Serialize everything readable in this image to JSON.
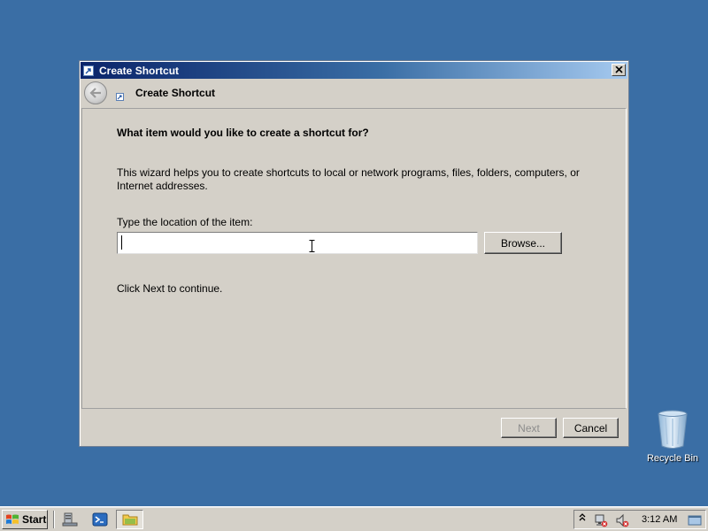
{
  "window": {
    "title": "Create Shortcut",
    "close_label": "×"
  },
  "wizard": {
    "header_title": "Create Shortcut",
    "question": "What item would you like to create a shortcut for?",
    "description": "This wizard helps you to create shortcuts to local or network programs, files, folders, computers, or Internet addresses.",
    "location_label": "Type the location of the item:",
    "location_value": "",
    "browse_label": "Browse...",
    "continue_text": "Click Next to continue.",
    "next_label": "Next",
    "next_enabled": false,
    "cancel_label": "Cancel"
  },
  "desktop": {
    "icons": [
      {
        "label": "Recycle Bin",
        "icon": "recycle-bin-icon"
      }
    ],
    "background_color": "#3a6ea5"
  },
  "taskbar": {
    "start_label": "Start",
    "quick_launch": [
      "server-manager-icon",
      "powershell-icon",
      "explorer-icon"
    ],
    "tray_icons": [
      "show-hidden-icons-chevron",
      "network-icon",
      "volume-muted-icon"
    ],
    "clock": "3:12 AM"
  }
}
